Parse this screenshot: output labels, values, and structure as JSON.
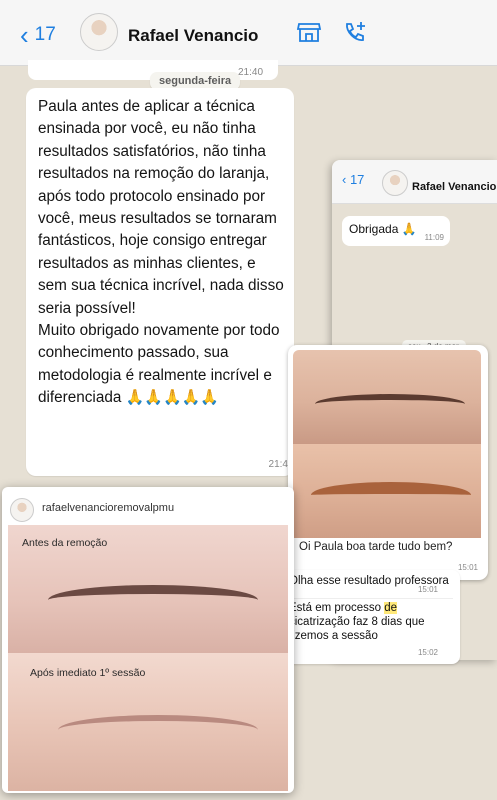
{
  "main_chat": {
    "back_count": "17",
    "contact_name": "Rafael Venancio",
    "prev_time": "21:40",
    "day_chip": "segunda-feira",
    "message_text": "Paula antes de aplicar a técnica ensinada por você, eu não tinha resultados satisfatórios, não tinha resultados na remoção do laranja, após todo protocolo ensinado por você, meus resultados se tornaram fantásticos, hoje consigo entregar resultados as minhas clientes, e sem sua técnica incrível, nada disso seria possível!",
    "message_text_2": "Muito obrigado novamente por todo conhecimento passado, sua metodologia é realmente incrível e diferenciada",
    "message_emojis": "🙏🙏🙏🙏🙏",
    "message_time": "21:4"
  },
  "second_chat": {
    "back_count": "17",
    "contact_name": "Rafael Venancio",
    "obrigada_text": "Obrigada 🙏",
    "obrigada_time": "11:09",
    "day_chip": "sex., 3 de mar.",
    "photo_caption": "Oi Paula boa tarde tudo bem?",
    "photo_time": "15:01",
    "msg_line1": "Olha esse resultado professora",
    "msg_line2_pre": "Está em processo ",
    "msg_line2_hl": "de",
    "msg_line3": "cicatrização faz 8 dias que",
    "msg_line4": "fizemos a sessão",
    "msg_time": "15:02"
  },
  "instagram": {
    "username": "rafaelvenancioremovalpmu",
    "label_before": "Antes da remoção",
    "label_after": "Após imediato 1º sessão"
  },
  "icons": {
    "back": "chevron-left-icon",
    "store": "store-icon",
    "call": "add-call-icon"
  },
  "colors": {
    "accent": "#1f7fe0",
    "chat_bg": "#e6e0d4",
    "bubble": "#ffffff",
    "highlight": "#ffe97a"
  }
}
